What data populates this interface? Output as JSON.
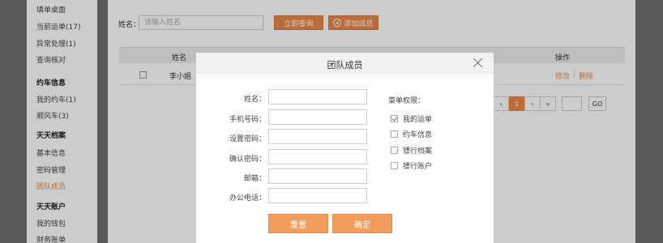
{
  "sidebar": {
    "items": [
      {
        "label": "填单桌面",
        "type": "item"
      },
      {
        "label": "当前运单(17)",
        "type": "item"
      },
      {
        "label": "异常处理(1)",
        "type": "item"
      },
      {
        "label": "查询核对",
        "type": "item"
      },
      {
        "label": "约车信息",
        "type": "heading"
      },
      {
        "label": "我的约车(1)",
        "type": "item"
      },
      {
        "label": "顺风车(3)",
        "type": "item"
      },
      {
        "label": "天天档案",
        "type": "heading"
      },
      {
        "label": "基本信息",
        "type": "item"
      },
      {
        "label": "密码管理",
        "type": "item"
      },
      {
        "label": "团队成员",
        "type": "active"
      },
      {
        "label": "天天账户",
        "type": "heading"
      },
      {
        "label": "我的钱包",
        "type": "item"
      },
      {
        "label": "财务账单",
        "type": "item"
      }
    ]
  },
  "search": {
    "label": "姓名：",
    "placeholder": "请输入姓名",
    "query_button": "立即查询",
    "add_button": "添加成员"
  },
  "table": {
    "headers": {
      "name": "姓名",
      "ops": "操作"
    },
    "rows": [
      {
        "name": "李小姐",
        "edit": "修改",
        "sep": "|",
        "delete": "删除"
      }
    ]
  },
  "pagination": {
    "prev_first": "«",
    "prev": "‹",
    "current": "1",
    "next": "›",
    "next_last": "»",
    "go": "GO"
  },
  "modal": {
    "title": "团队成员",
    "fields": [
      {
        "label": "姓名："
      },
      {
        "label": "手机号码："
      },
      {
        "label": "设置密码："
      },
      {
        "label": "确认密码："
      },
      {
        "label": "邮箱："
      },
      {
        "label": "办公电话："
      }
    ],
    "permissions_title": "菜单权限：",
    "permissions": [
      {
        "label": "我的运单",
        "checked": true
      },
      {
        "label": "约车信息",
        "checked": false
      },
      {
        "label": "镖行档案",
        "checked": false
      },
      {
        "label": "镖行账户",
        "checked": false
      }
    ],
    "reset_button": "重置",
    "confirm_button": "确定"
  },
  "colors": {
    "accent": "#e8894a",
    "button": "#f29d5e",
    "overlay": "rgba(0,0,0,0.2)"
  }
}
